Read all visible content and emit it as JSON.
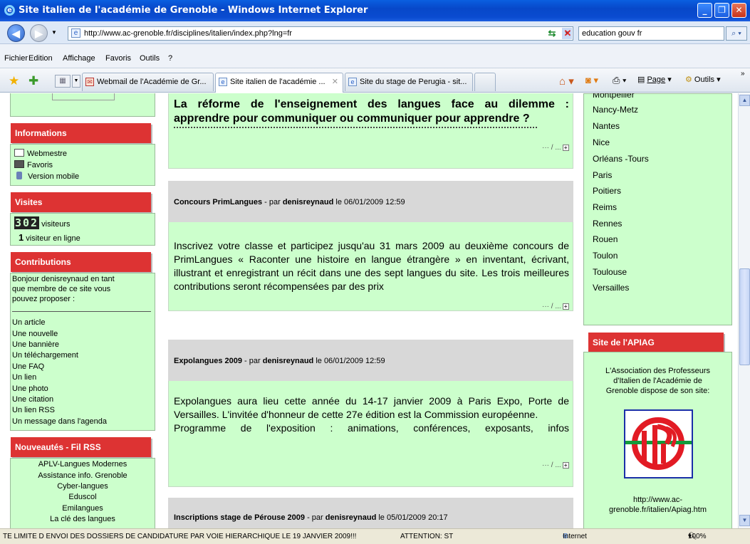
{
  "window": {
    "title": "Site italien de l'académie de Grenoble - Windows Internet Explorer"
  },
  "address": {
    "url": "http://www.ac-grenoble.fr/disciplines/italien/index.php?lng=fr",
    "search_value": "education gouv fr"
  },
  "menu": [
    "Fichier",
    "Edition",
    "Affichage",
    "Favoris",
    "Outils",
    "?"
  ],
  "tabs": [
    {
      "label": "Webmail de l'Académie de Gr..."
    },
    {
      "label": "Site italien de l'académie ..."
    },
    {
      "label": "Site du stage de Perugia - sit..."
    }
  ],
  "toolbar": {
    "page_label": "Page",
    "tools_label": "Outils"
  },
  "left": {
    "informations": {
      "title": "Informations",
      "items": [
        "Webmestre",
        "Favoris",
        "Version mobile"
      ]
    },
    "visites": {
      "title": "Visites",
      "count": "302",
      "visitors_label": "visiteurs",
      "online_label": "visiteur en ligne",
      "online_count": "1"
    },
    "contributions": {
      "title": "Contributions",
      "intro": [
        "Bonjour denisreynaud en tant",
        "que membre de ce site vous",
        "pouvez proposer :"
      ],
      "items": [
        "Un article",
        "Une nouvelle",
        "Une bannière",
        "Un téléchargement",
        "Une FAQ",
        "Un lien",
        "Une photo",
        "Une citation",
        "Un lien RSS",
        "Un message dans l'agenda"
      ]
    },
    "rss": {
      "title": "Nouveautés - Fil RSS",
      "items": [
        "APLV-Langues Modernes",
        "Assistance info. Grenoble",
        "Cyber-langues",
        "Eduscol",
        "Emilangues",
        "La clé des langues"
      ]
    }
  },
  "articles": [
    {
      "title_lines": [
        "La réforme de l'enseignement des langues face au dilemme :",
        "apprendre pour communiquer ou communiquer pour apprendre ?"
      ],
      "more": "··· / ..."
    },
    {
      "title": "Concours PrimLangues",
      "sep": " - par ",
      "author": "denisreynaud",
      "date": " le 06/01/2009 12:59",
      "body": "Inscrivez votre classe et participez jusqu'au 31 mars 2009 au deuxième concours de PrimLangues « Raconter une histoire en langue étrangère » en inventant, écrivant, illustrant et enregistrant un récit dans une des sept langues du site. Les trois meilleures contributions seront récompensées par des prix",
      "more": "··· / ..."
    },
    {
      "title": "Expolangues 2009",
      "sep": " - par ",
      "author": "denisreynaud",
      "date": " le 06/01/2009 12:59",
      "body": "Expolangues aura lieu cette année du 14-17 janvier 2009 à Paris Expo, Porte de Versailles. L'invitée d'honneur de cette 27e édition est la Commission européenne.",
      "body2": "Programme de l'exposition : animations, conférences, exposants, infos",
      "more": "··· / ..."
    },
    {
      "title": "Inscriptions stage de Pérouse 2009",
      "sep": " - par ",
      "author": "denisreynaud",
      "date": " le 05/01/2009 20:17"
    }
  ],
  "right": {
    "cities": [
      "Montpellier",
      "Nancy-Metz",
      "Nantes",
      "Nice",
      "Orléans -Tours",
      "Paris",
      "Poitiers",
      "Reims",
      "Rennes",
      "Rouen",
      "Toulon",
      "Toulouse",
      "Versailles"
    ],
    "apiag": {
      "title": "Site de l'APIAG",
      "text": [
        "L'Association des Professeurs",
        "d'Italien de l'Académie de",
        "Grenoble dispose de son site:"
      ],
      "link": [
        "http://www.ac-",
        "grenoble.fr/italien/Apiag.htm"
      ]
    }
  },
  "status": {
    "message": "TE LIMITE D ENVOI DES DOSSIERS DE CANDIDATURE PAR VOIE HIERARCHIQUE LE 19 JANVIER 2009!!!",
    "attention": "ATTENTION: ST",
    "zone": "Internet",
    "zoom": "100%"
  },
  "colors": {
    "accent_red": "#dd3333",
    "panel_green": "#ccffcc",
    "header_grey": "#d8d8d8",
    "titlebar_blue": "#0a5fe0"
  }
}
